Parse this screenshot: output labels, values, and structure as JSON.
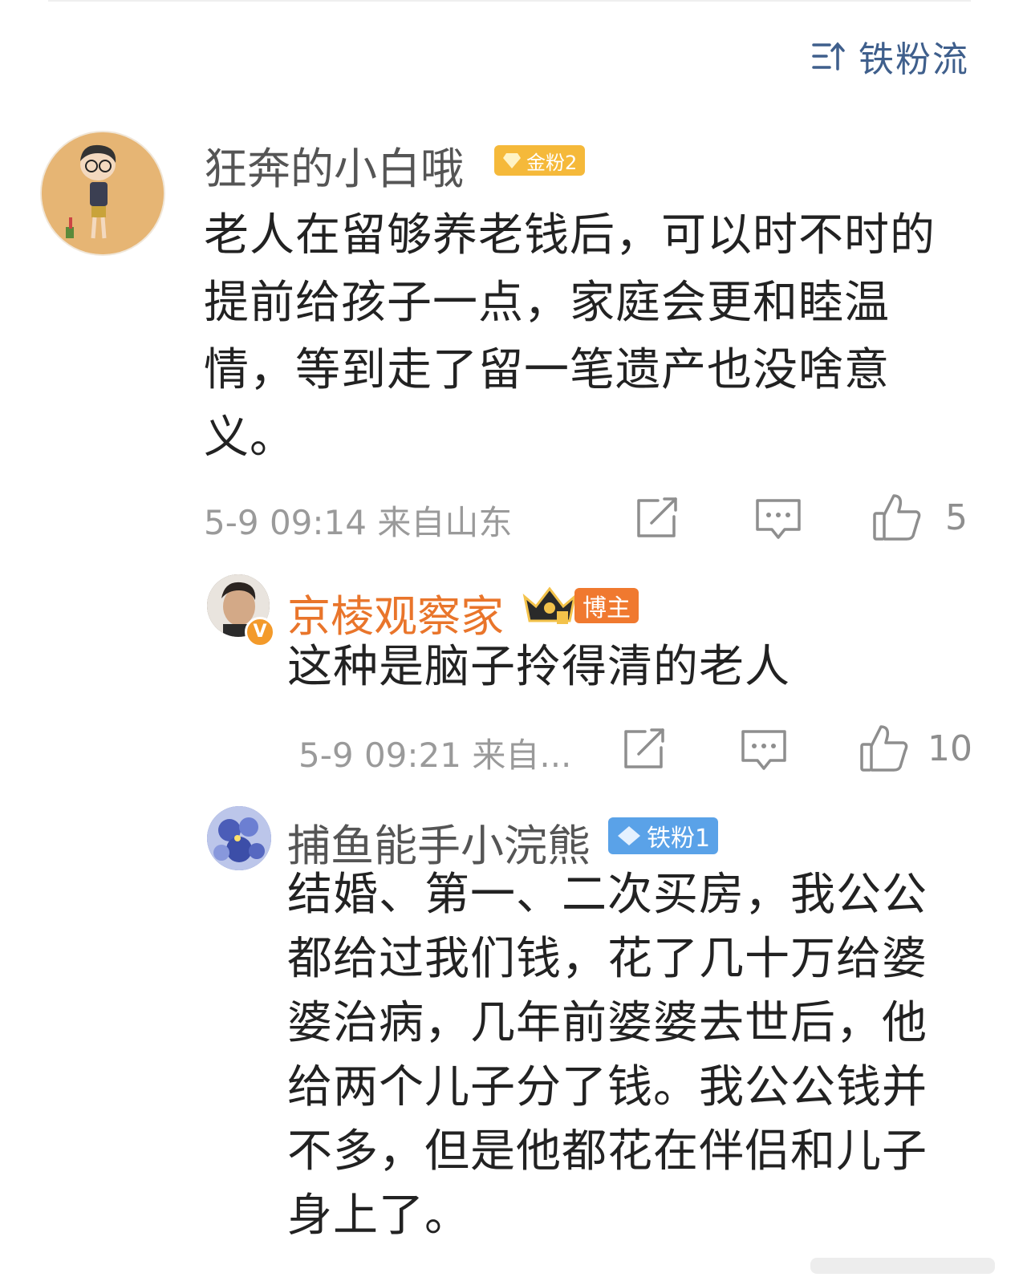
{
  "sort_toggle": {
    "label": "铁粉流",
    "icon": "sort-icon"
  },
  "comments": [
    {
      "user": "狂奔的小白哦",
      "badge": "金粉2",
      "text": "老人在留够养老钱后，可以时不时的提前给孩子一点，家庭会更和睦温情，等到走了留一笔遗产也没啥意义。",
      "time_loc": "5-9 09:14 来自山东",
      "likes": "5"
    },
    {
      "user": "京棱观察家",
      "badge": "博主",
      "text": "这种是脑子拎得清的老人",
      "time_loc": "5-9 09:21 来自...",
      "likes": "10"
    },
    {
      "user": "捕鱼能手小浣熊",
      "badge": "铁粉1",
      "text": "结婚、第一、二次买房，我公公都给过我们钱，花了几十万给婆婆治病，几年前婆婆去世后，他给两个儿子分了钱。我公公钱并不多，但是他都花在伴侣和儿子身上了。"
    }
  ],
  "colors": {
    "gold_badge": "#f5b93a",
    "blogger_name": "#e9752b",
    "fan_badge": "#5aa2e8",
    "link": "#3f5f8c"
  }
}
